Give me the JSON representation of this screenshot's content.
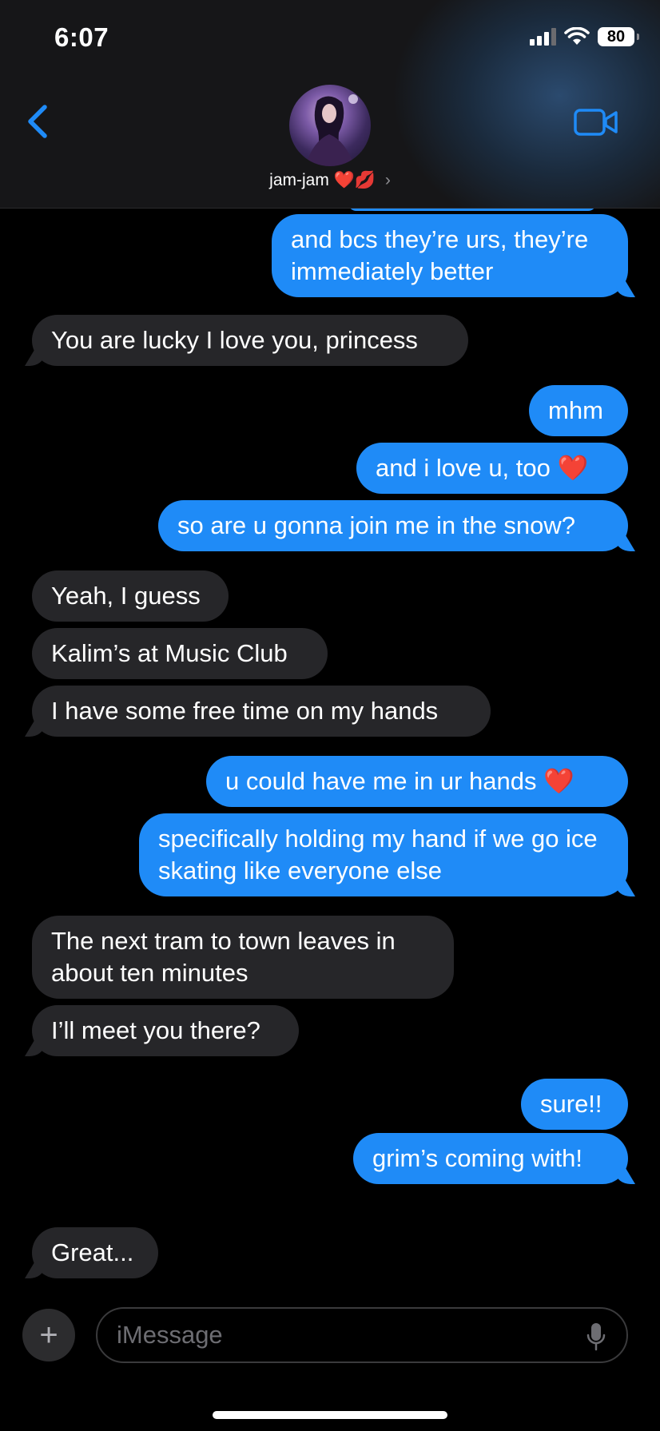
{
  "status_bar": {
    "time": "6:07",
    "battery": "80"
  },
  "header": {
    "contact_name": "jam-jam",
    "contact_emojis": "❤️💋",
    "chevron": "›",
    "back_icon": "chevron-left-icon",
    "video_icon": "video-camera-icon"
  },
  "messages": [
    {
      "sender": "me",
      "text": "and bcs they’re urs, they’re immediately better"
    },
    {
      "sender": "them",
      "text": "You are lucky I love you, princess"
    },
    {
      "sender": "me",
      "text": "mhm"
    },
    {
      "sender": "me",
      "text": "and i love u, too ",
      "emoji": "❤️"
    },
    {
      "sender": "me",
      "text": "so are u gonna join me in the snow?"
    },
    {
      "sender": "them",
      "text": "Yeah, I guess"
    },
    {
      "sender": "them",
      "text": "Kalim’s at Music Club"
    },
    {
      "sender": "them",
      "text": "I have some free time on my hands"
    },
    {
      "sender": "me",
      "text": "u could have me in ur hands ",
      "emoji": "❤️"
    },
    {
      "sender": "me",
      "text": "specifically holding my hand if we go ice skating like everyone else"
    },
    {
      "sender": "them",
      "text": "The next tram to town leaves in about ten minutes"
    },
    {
      "sender": "them",
      "text": "I’ll meet you there?"
    },
    {
      "sender": "me",
      "text": "sure!!"
    },
    {
      "sender": "me",
      "text": "grim’s coming with!"
    },
    {
      "sender": "them",
      "text": "Great..."
    }
  ],
  "composer": {
    "placeholder": "iMessage",
    "plus": "+"
  },
  "colors": {
    "sent": "#1f8bf7",
    "received": "#262629",
    "background": "#000000"
  }
}
